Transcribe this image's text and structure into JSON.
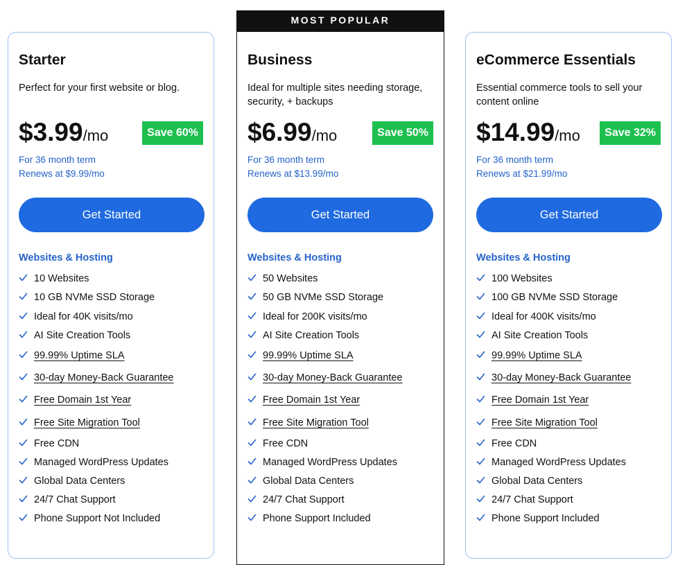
{
  "ribbon": "MOST POPULAR",
  "section_title": "Websites & Hosting",
  "cta_label": "Get Started",
  "colors": {
    "accent": "#1f6ae0",
    "link": "#2563c9",
    "save": "#1dbf4f",
    "ribbon": "#0f1113"
  },
  "plans": [
    {
      "name": "Starter",
      "desc": "Perfect for your first website or blog.",
      "price": "$3.99",
      "per": "/mo",
      "save": "Save 60%",
      "term": "For 36 month term",
      "renews": "Renews at $9.99/mo",
      "features": [
        "10 Websites",
        "10 GB NVMe SSD Storage",
        "Ideal for 40K visits/mo",
        "AI Site Creation Tools",
        "99.99% Uptime SLA",
        "30-day Money-Back Guarantee",
        "Free Domain 1st Year",
        "Free Site Migration Tool",
        "Free CDN",
        "Managed WordPress Updates",
        "Global Data Centers",
        "24/7 Chat Support",
        "Phone Support Not Included"
      ]
    },
    {
      "name": "Business",
      "desc": "Ideal for multiple sites needing storage, security, + backups",
      "price": "$6.99",
      "per": "/mo",
      "save": "Save 50%",
      "term": "For 36 month term",
      "renews": "Renews at $13.99/mo",
      "features": [
        "50 Websites",
        "50 GB NVMe SSD Storage",
        "Ideal for 200K visits/mo",
        "AI Site Creation Tools",
        "99.99% Uptime SLA",
        "30-day Money-Back Guarantee",
        "Free Domain 1st Year",
        "Free Site Migration Tool",
        "Free CDN",
        "Managed WordPress Updates",
        "Global Data Centers",
        "24/7 Chat Support",
        "Phone Support Included"
      ]
    },
    {
      "name": "eCommerce Essentials",
      "desc": "Essential commerce tools to sell your content online",
      "price": "$14.99",
      "per": "/mo",
      "save": "Save 32%",
      "term": "For 36 month term",
      "renews": "Renews at $21.99/mo",
      "features": [
        "100 Websites",
        "100 GB NVMe SSD Storage",
        "Ideal for 400K visits/mo",
        "AI Site Creation Tools",
        "99.99% Uptime SLA",
        "30-day Money-Back Guarantee",
        "Free Domain 1st Year",
        "Free Site Migration Tool",
        "Free CDN",
        "Managed WordPress Updates",
        "Global Data Centers",
        "24/7 Chat Support",
        "Phone Support Included"
      ]
    }
  ]
}
